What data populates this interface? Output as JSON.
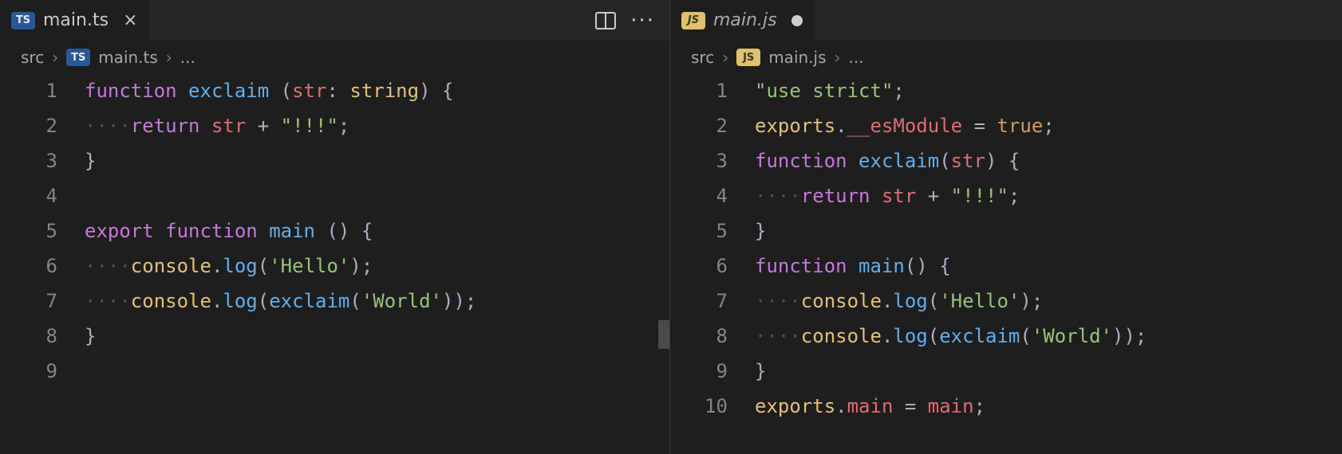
{
  "panes": [
    {
      "tab": {
        "badge": "TS",
        "label": "main.ts",
        "active": true,
        "modified": false,
        "italic": false
      },
      "actions": true,
      "breadcrumb": {
        "folder": "src",
        "badge": "TS",
        "file": "main.ts",
        "tail": "..."
      },
      "lines": [
        {
          "n": 1,
          "tokens": [
            [
              "kw",
              "function"
            ],
            [
              "op",
              " "
            ],
            [
              "fn",
              "exclaim"
            ],
            [
              "op",
              " "
            ],
            [
              "pn",
              "("
            ],
            [
              "var",
              "str"
            ],
            [
              "pn",
              ":"
            ],
            [
              "op",
              " "
            ],
            [
              "ty",
              "string"
            ],
            [
              "pn",
              ")"
            ],
            [
              "op",
              " "
            ],
            [
              "pn",
              "{"
            ]
          ]
        },
        {
          "n": 2,
          "indent": 4,
          "tokens": [
            [
              "kw",
              "return"
            ],
            [
              "op",
              " "
            ],
            [
              "var",
              "str"
            ],
            [
              "op",
              " "
            ],
            [
              "op",
              "+"
            ],
            [
              "op",
              " "
            ],
            [
              "str",
              "\"!!!\""
            ],
            [
              "pn",
              ";"
            ]
          ]
        },
        {
          "n": 3,
          "tokens": [
            [
              "pn",
              "}"
            ]
          ]
        },
        {
          "n": 4,
          "tokens": []
        },
        {
          "n": 5,
          "tokens": [
            [
              "kw",
              "export"
            ],
            [
              "op",
              " "
            ],
            [
              "kw",
              "function"
            ],
            [
              "op",
              " "
            ],
            [
              "fn",
              "main"
            ],
            [
              "op",
              " "
            ],
            [
              "pn",
              "("
            ],
            [
              "pn",
              ")"
            ],
            [
              "op",
              " "
            ],
            [
              "pn",
              "{"
            ]
          ]
        },
        {
          "n": 6,
          "indent": 4,
          "tokens": [
            [
              "id",
              "console"
            ],
            [
              "pn",
              "."
            ],
            [
              "fn",
              "log"
            ],
            [
              "pn",
              "("
            ],
            [
              "str",
              "'Hello'"
            ],
            [
              "pn",
              ")"
            ],
            [
              "pn",
              ";"
            ]
          ]
        },
        {
          "n": 7,
          "indent": 4,
          "tokens": [
            [
              "id",
              "console"
            ],
            [
              "pn",
              "."
            ],
            [
              "fn",
              "log"
            ],
            [
              "pn",
              "("
            ],
            [
              "fn",
              "exclaim"
            ],
            [
              "pn",
              "("
            ],
            [
              "str",
              "'World'"
            ],
            [
              "pn",
              ")"
            ],
            [
              "pn",
              ")"
            ],
            [
              "pn",
              ";"
            ]
          ]
        },
        {
          "n": 8,
          "tokens": [
            [
              "pn",
              "}"
            ]
          ]
        },
        {
          "n": 9,
          "tokens": []
        }
      ]
    },
    {
      "tab": {
        "badge": "JS",
        "label": "main.js",
        "active": true,
        "modified": true,
        "italic": true
      },
      "actions": false,
      "breadcrumb": {
        "folder": "src",
        "badge": "JS",
        "file": "main.js",
        "tail": "..."
      },
      "lines": [
        {
          "n": 1,
          "tokens": [
            [
              "str",
              "\"use strict\""
            ],
            [
              "pn",
              ";"
            ]
          ]
        },
        {
          "n": 2,
          "tokens": [
            [
              "id",
              "exports"
            ],
            [
              "pn",
              "."
            ],
            [
              "pr",
              "__esModule"
            ],
            [
              "op",
              " "
            ],
            [
              "op",
              "="
            ],
            [
              "op",
              " "
            ],
            [
              "cns",
              "true"
            ],
            [
              "pn",
              ";"
            ]
          ]
        },
        {
          "n": 3,
          "tokens": [
            [
              "kw",
              "function"
            ],
            [
              "op",
              " "
            ],
            [
              "fn",
              "exclaim"
            ],
            [
              "pn",
              "("
            ],
            [
              "var",
              "str"
            ],
            [
              "pn",
              ")"
            ],
            [
              "op",
              " "
            ],
            [
              "pn",
              "{"
            ]
          ]
        },
        {
          "n": 4,
          "indent": 4,
          "tokens": [
            [
              "kw",
              "return"
            ],
            [
              "op",
              " "
            ],
            [
              "var",
              "str"
            ],
            [
              "op",
              " "
            ],
            [
              "op",
              "+"
            ],
            [
              "op",
              " "
            ],
            [
              "str",
              "\"!!!\""
            ],
            [
              "pn",
              ";"
            ]
          ]
        },
        {
          "n": 5,
          "tokens": [
            [
              "pn",
              "}"
            ]
          ]
        },
        {
          "n": 6,
          "tokens": [
            [
              "kw",
              "function"
            ],
            [
              "op",
              " "
            ],
            [
              "fn",
              "main"
            ],
            [
              "pn",
              "("
            ],
            [
              "pn",
              ")"
            ],
            [
              "op",
              " "
            ],
            [
              "pn",
              "{"
            ]
          ]
        },
        {
          "n": 7,
          "indent": 4,
          "tokens": [
            [
              "id",
              "console"
            ],
            [
              "pn",
              "."
            ],
            [
              "fn",
              "log"
            ],
            [
              "pn",
              "("
            ],
            [
              "str",
              "'Hello'"
            ],
            [
              "pn",
              ")"
            ],
            [
              "pn",
              ";"
            ]
          ]
        },
        {
          "n": 8,
          "indent": 4,
          "tokens": [
            [
              "id",
              "console"
            ],
            [
              "pn",
              "."
            ],
            [
              "fn",
              "log"
            ],
            [
              "pn",
              "("
            ],
            [
              "fn",
              "exclaim"
            ],
            [
              "pn",
              "("
            ],
            [
              "str",
              "'World'"
            ],
            [
              "pn",
              ")"
            ],
            [
              "pn",
              ")"
            ],
            [
              "pn",
              ";"
            ]
          ]
        },
        {
          "n": 9,
          "tokens": [
            [
              "pn",
              "}"
            ]
          ]
        },
        {
          "n": 10,
          "tokens": [
            [
              "id",
              "exports"
            ],
            [
              "pn",
              "."
            ],
            [
              "pr",
              "main"
            ],
            [
              "op",
              " "
            ],
            [
              "op",
              "="
            ],
            [
              "op",
              " "
            ],
            [
              "var",
              "main"
            ],
            [
              "pn",
              ";"
            ]
          ]
        }
      ]
    }
  ]
}
